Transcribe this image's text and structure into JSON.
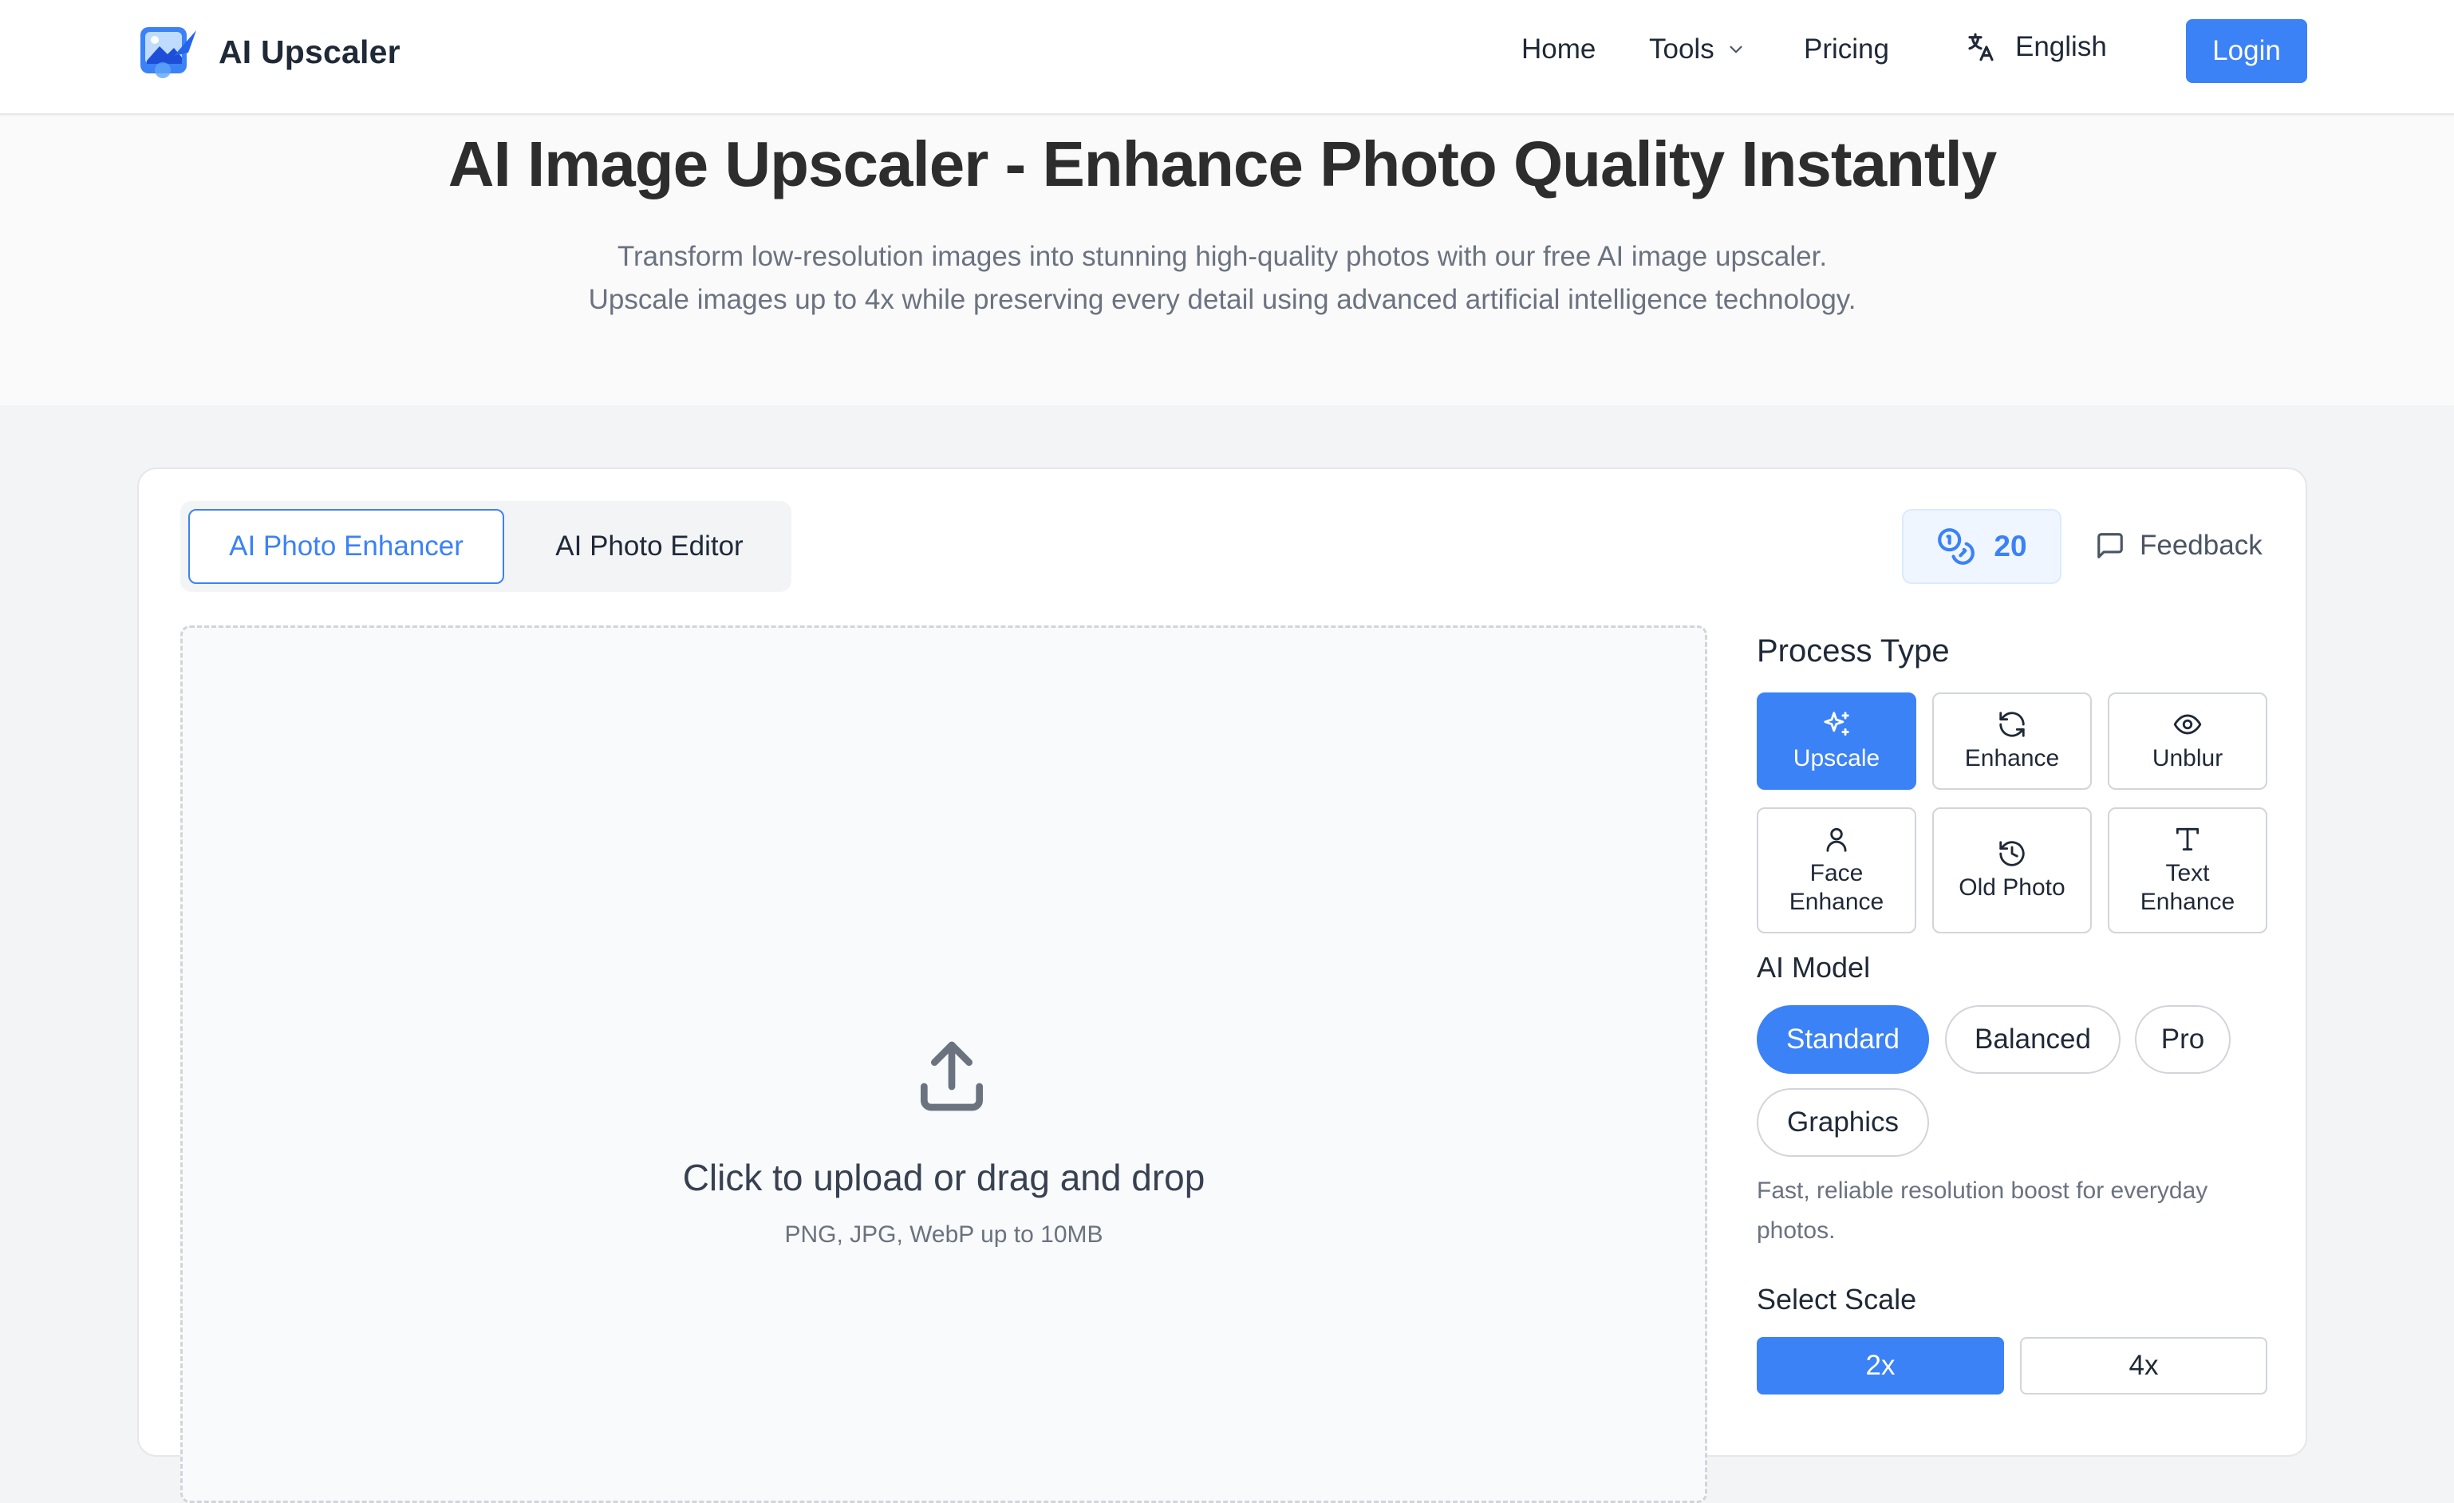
{
  "header": {
    "brand": "AI Upscaler",
    "nav": {
      "home": "Home",
      "tools": "Tools",
      "pricing": "Pricing",
      "language": "English"
    },
    "login": "Login"
  },
  "hero": {
    "title": "AI Image Upscaler - Enhance Photo Quality Instantly",
    "subtitle_line1": "Transform low-resolution images into stunning high-quality photos with our free AI image upscaler.",
    "subtitle_line2": "Upscale images up to 4x while preserving every detail using advanced artificial intelligence technology."
  },
  "tabs": {
    "enhancer": "AI Photo Enhancer",
    "editor": "AI Photo Editor",
    "active": "AI Photo Enhancer"
  },
  "credits": {
    "count": "20",
    "icon": "coins-icon"
  },
  "feedback": {
    "label": "Feedback",
    "icon": "message-square-icon"
  },
  "upload": {
    "title": "Click to upload or drag and drop",
    "hint": "PNG, JPG, WebP up to 10MB",
    "icon": "upload-icon"
  },
  "process_type": {
    "label": "Process Type",
    "options": [
      {
        "label": "Upscale",
        "icon": "sparkles-icon",
        "active": true
      },
      {
        "label": "Enhance",
        "icon": "refresh-icon",
        "active": false
      },
      {
        "label": "Unblur",
        "icon": "eye-icon",
        "active": false
      },
      {
        "label_line1": "Face",
        "label_line2": "Enhance",
        "icon": "user-icon",
        "active": false
      },
      {
        "label": "Old Photo",
        "icon": "history-icon",
        "active": false
      },
      {
        "label_line1": "Text",
        "label_line2": "Enhance",
        "icon": "type-icon",
        "active": false
      }
    ]
  },
  "ai_model": {
    "label": "AI Model",
    "options": [
      "Standard",
      "Balanced",
      "Pro",
      "Graphics"
    ],
    "selected": "Standard",
    "description": "Fast, reliable resolution boost for everyday photos."
  },
  "scale": {
    "label": "Select Scale",
    "options": [
      "2x",
      "4x"
    ],
    "selected": "2x"
  },
  "colors": {
    "accent": "#3b82f6",
    "text": "#1f2937",
    "muted": "#6b7280",
    "border": "#d1d5db",
    "page_bg": "#f3f4f6"
  }
}
